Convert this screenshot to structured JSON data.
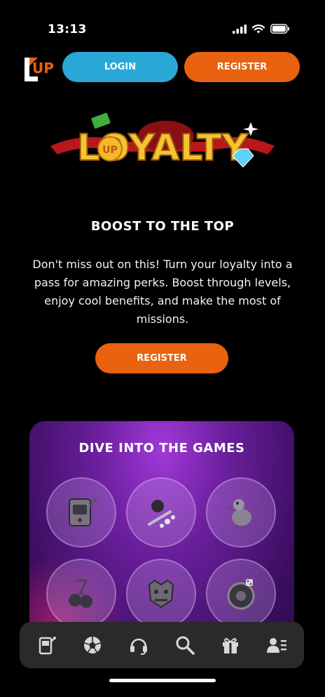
{
  "status_bar": {
    "time": "13:13"
  },
  "header": {
    "logo_text": "UP",
    "login_label": "LOGIN",
    "register_label": "REGISTER"
  },
  "banner": {
    "title_text": "LOYALTY"
  },
  "boost": {
    "title": "BOOST TO THE TOP",
    "description": "Don't miss out on this! Turn your loyalty into a pass for amazing perks. Boost through levels, enjoy cool benefits, and make the most of missions.",
    "register_label": "REGISTER"
  },
  "games": {
    "title": "DIVE INTO THE GAMES",
    "tiles": [
      "slot-machine-icon",
      "pinball-icon",
      "dodo-bird-icon",
      "cherries-icon",
      "dragon-mask-icon",
      "roulette-icon"
    ]
  },
  "bottom_nav": {
    "items": [
      "slots-icon",
      "sports-ball-icon",
      "support-headset-icon",
      "search-icon",
      "gift-icon",
      "profile-icon"
    ]
  },
  "colors": {
    "login_button": "#29a8d8",
    "register_button": "#e8620f",
    "games_card": "#6a1f9c",
    "nav_background": "#2a2a2c"
  }
}
